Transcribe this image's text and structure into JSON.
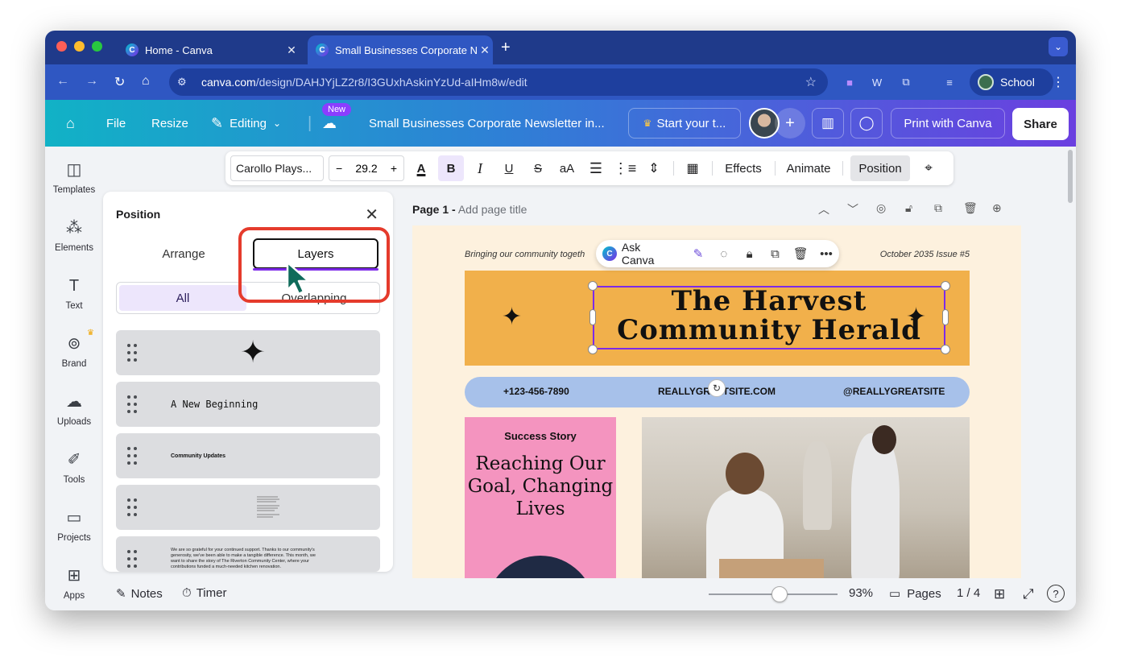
{
  "browser": {
    "tabs": [
      {
        "title": "Home - Canva"
      },
      {
        "title": "Small Businesses Corporate N"
      }
    ],
    "url_host": "canva.com",
    "url_path": "/design/DAHJYjLZ2r8/I3GUxhAskinYzUd-aIHm8w/edit",
    "profile": "School"
  },
  "header": {
    "file": "File",
    "resize": "Resize",
    "editing": "Editing",
    "new_badge": "New",
    "doc_title": "Small Businesses Corporate Newsletter in...",
    "start_trial": "Start your t...",
    "print": "Print with Canva",
    "share": "Share"
  },
  "rail": {
    "items": [
      {
        "label": "Templates",
        "icon": "templates-icon"
      },
      {
        "label": "Elements",
        "icon": "elements-icon"
      },
      {
        "label": "Text",
        "icon": "text-icon"
      },
      {
        "label": "Brand",
        "icon": "brand-icon"
      },
      {
        "label": "Uploads",
        "icon": "uploads-icon"
      },
      {
        "label": "Tools",
        "icon": "tools-icon"
      },
      {
        "label": "Projects",
        "icon": "projects-icon"
      },
      {
        "label": "Apps",
        "icon": "apps-icon"
      }
    ]
  },
  "toolbar": {
    "font": "Carollo Plays...",
    "size": "29.2",
    "effects": "Effects",
    "animate": "Animate",
    "position": "Position"
  },
  "panel": {
    "title": "Position",
    "tab_arrange": "Arrange",
    "tab_layers": "Layers",
    "filter_all": "All",
    "filter_overlapping": "Overlapping",
    "layers": [
      {
        "label": "",
        "kind": "sparkle-icon"
      },
      {
        "label": "A New Beginning"
      },
      {
        "label": "Community Updates"
      },
      {
        "label": ""
      },
      {
        "label": "We are so grateful for your continued support. Thanks to our community's generosity, we've been able to make a tangible difference. This month, we want to share the story of The Riverton Community Center, where your contributions funded a much-needed kitchen renovation."
      }
    ]
  },
  "canvas": {
    "page_label": "Page 1 -",
    "page_title_placeholder": "Add page title",
    "ask_canva": "Ask Canva",
    "tagline": "Bringing our community togeth",
    "issue": "October 2035 Issue #5",
    "title_line1": "The Harvest",
    "title_line2": "Community Herald",
    "phone": "+123-456-7890",
    "site": "REALLYGREATSITE.COM",
    "handle": "@REALLYGREATSITE",
    "story_kicker": "Success Story",
    "story_title": "Reaching Our Goal, Changing Lives",
    "colors": {
      "banner": "#f1b04b",
      "contact": "#a7c1ea",
      "pink": "#f494bf",
      "page": "#fdf1de"
    }
  },
  "footer": {
    "notes": "Notes",
    "timer": "Timer",
    "zoom": "93%",
    "pages": "Pages",
    "page_count": "1 / 4"
  }
}
